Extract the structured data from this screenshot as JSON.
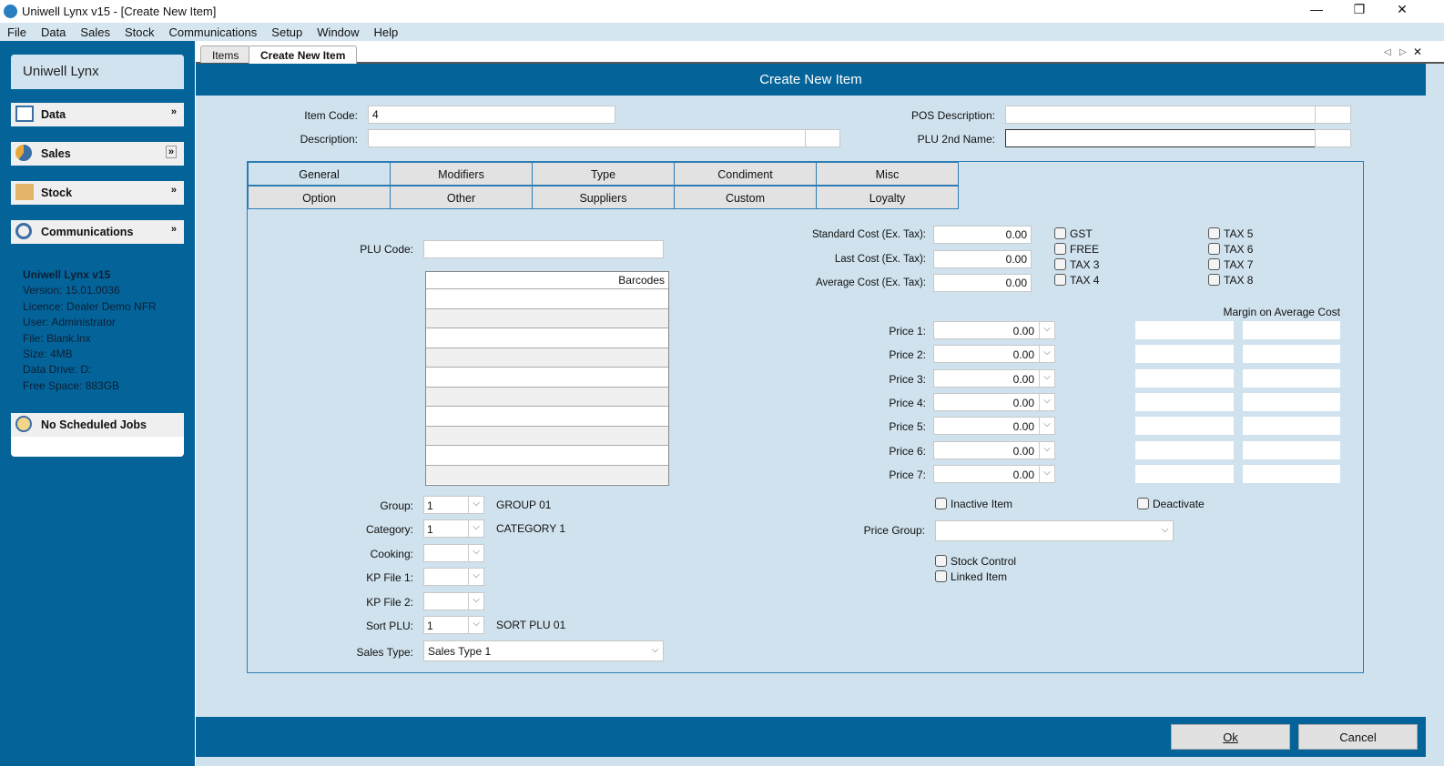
{
  "window": {
    "title": "Uniwell Lynx v15 - [Create New Item]",
    "minimize": "—",
    "maximize": "❐",
    "close": "✕"
  },
  "menu": [
    "File",
    "Data",
    "Sales",
    "Stock",
    "Communications",
    "Setup",
    "Window",
    "Help"
  ],
  "sidebar": {
    "title": "Uniwell Lynx",
    "sections": [
      {
        "label": "Data"
      },
      {
        "label": "Sales"
      },
      {
        "label": "Stock"
      },
      {
        "label": "Communications"
      }
    ],
    "info": {
      "heading": "Uniwell Lynx v15",
      "lines": [
        "Version: 15.01.0036",
        "Licence: Dealer Demo NFR",
        "User: Administrator",
        "File: Blank.lnx",
        "Size: 4MB",
        "Data Drive: D:",
        "Free Space: 883GB"
      ]
    },
    "jobs": "No Scheduled Jobs"
  },
  "doc_tabs": [
    "Items",
    "Create New Item"
  ],
  "header": "Create New Item",
  "form": {
    "item_code_label": "Item Code:",
    "item_code": "4",
    "description_label": "Description:",
    "description": "",
    "pos_description_label": "POS Description:",
    "plu_2nd_name_label": "PLU 2nd Name:"
  },
  "tabs_row1": [
    "General",
    "Modifiers",
    "Type",
    "Condiment",
    "Misc"
  ],
  "tabs_row2": [
    "Option",
    "Other",
    "Suppliers",
    "Custom",
    "Loyalty"
  ],
  "general": {
    "plu_code_label": "PLU Code:",
    "barcodes_header": "Barcodes",
    "group_label": "Group:",
    "group_value": "1",
    "group_name": "GROUP 01",
    "category_label": "Category:",
    "category_value": "1",
    "category_name": "CATEGORY 1",
    "cooking_label": "Cooking:",
    "kp1_label": "KP File 1:",
    "kp2_label": "KP File 2:",
    "sort_plu_label": "Sort PLU:",
    "sort_plu_value": "1",
    "sort_plu_name": "SORT PLU 01",
    "sales_type_label": "Sales Type:",
    "sales_type_value": "Sales Type 1",
    "costs": [
      {
        "label": "Standard Cost (Ex. Tax):",
        "value": "0.00"
      },
      {
        "label": "Last Cost (Ex. Tax):",
        "value": "0.00"
      },
      {
        "label": "Average Cost (Ex. Tax):",
        "value": "0.00"
      }
    ],
    "taxes_left": [
      "GST",
      "FREE",
      "TAX 3",
      "TAX 4"
    ],
    "taxes_right": [
      "TAX 5",
      "TAX 6",
      "TAX 7",
      "TAX 8"
    ],
    "margin_label": "Margin on Average Cost",
    "prices": [
      {
        "label": "Price 1:",
        "value": "0.00"
      },
      {
        "label": "Price 2:",
        "value": "0.00"
      },
      {
        "label": "Price 3:",
        "value": "0.00"
      },
      {
        "label": "Price 4:",
        "value": "0.00"
      },
      {
        "label": "Price 5:",
        "value": "0.00"
      },
      {
        "label": "Price 6:",
        "value": "0.00"
      },
      {
        "label": "Price 7:",
        "value": "0.00"
      }
    ],
    "inactive_label": "Inactive Item",
    "deactivate_label": "Deactivate",
    "price_group_label": "Price Group:",
    "stock_control_label": "Stock Control",
    "linked_item_label": "Linked Item"
  },
  "buttons": {
    "ok": "Ok",
    "cancel": "Cancel"
  }
}
